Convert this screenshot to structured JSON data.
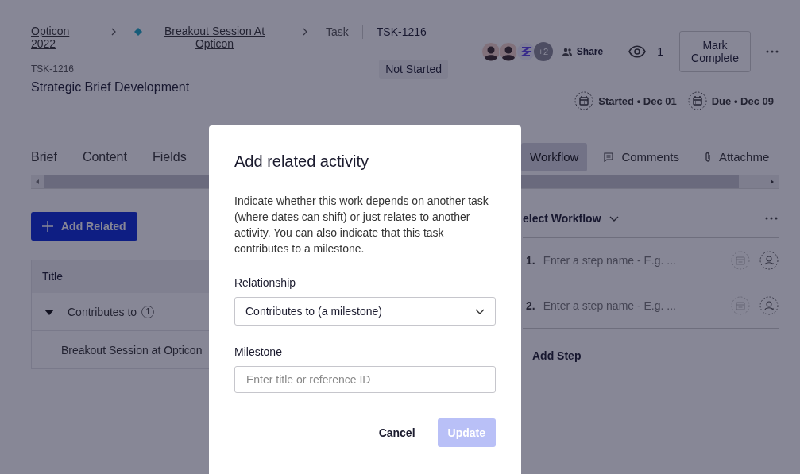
{
  "breadcrumb": [
    {
      "label": "Opticon 2022",
      "kind": "link"
    },
    {
      "label": "Breakout Session At Opticon",
      "kind": "milestone-link"
    },
    {
      "label": "Task",
      "kind": "text"
    },
    {
      "label": "TSK-1216",
      "kind": "current"
    }
  ],
  "task": {
    "id": "TSK-1216",
    "status": "Not Started",
    "title": "Strategic Brief Development"
  },
  "collaborators": {
    "avatars": [
      {
        "kind": "person"
      },
      {
        "kind": "person"
      },
      {
        "kind": "logo"
      }
    ],
    "extra": "+2"
  },
  "share": "Share",
  "watchers": "1",
  "mark_complete": "Mark Complete",
  "dates": [
    {
      "label": "Started • Dec 01"
    },
    {
      "label": "Due • Dec 09"
    }
  ],
  "left_tabs": [
    {
      "label": "Brief",
      "selected": false
    },
    {
      "label": "Content",
      "selected": false
    },
    {
      "label": "Fields",
      "selected": false
    }
  ],
  "right_tabs": [
    {
      "label": "Workflow",
      "selected": true,
      "kind": "plain"
    },
    {
      "label": "Comments",
      "selected": false,
      "kind": "comments"
    },
    {
      "label": "Attachme",
      "selected": false,
      "kind": "attachments"
    }
  ],
  "add_related": "Add Related",
  "related_table": {
    "columns": [
      "Title"
    ],
    "groups": [
      {
        "label": "Contributes to",
        "count": "1",
        "expanded": true,
        "children": [
          {
            "title": "Breakout Session at Opticon"
          }
        ]
      }
    ]
  },
  "workflow": {
    "selector": "elect Workflow",
    "steps": [
      {
        "number": "1.",
        "placeholder": "Enter a step name - E.g. ..."
      },
      {
        "number": "2.",
        "placeholder": "Enter a step name - E.g. ..."
      }
    ],
    "add_step": "Add Step"
  },
  "dialog": {
    "title": "Add related activity",
    "description": "Indicate whether this work depends on another task (where dates can shift) or just relates to another activity. You can also indicate that this task contributes to a milestone.",
    "fields": [
      {
        "label": "Relationship",
        "kind": "select",
        "value": "Contributes to (a milestone)"
      },
      {
        "label": "Milestone",
        "kind": "text",
        "placeholder": "Enter title or reference ID"
      }
    ],
    "buttons": [
      {
        "label": "Cancel",
        "kind": "secondary",
        "disabled": false
      },
      {
        "label": "Update",
        "kind": "primary",
        "disabled": true
      }
    ]
  }
}
